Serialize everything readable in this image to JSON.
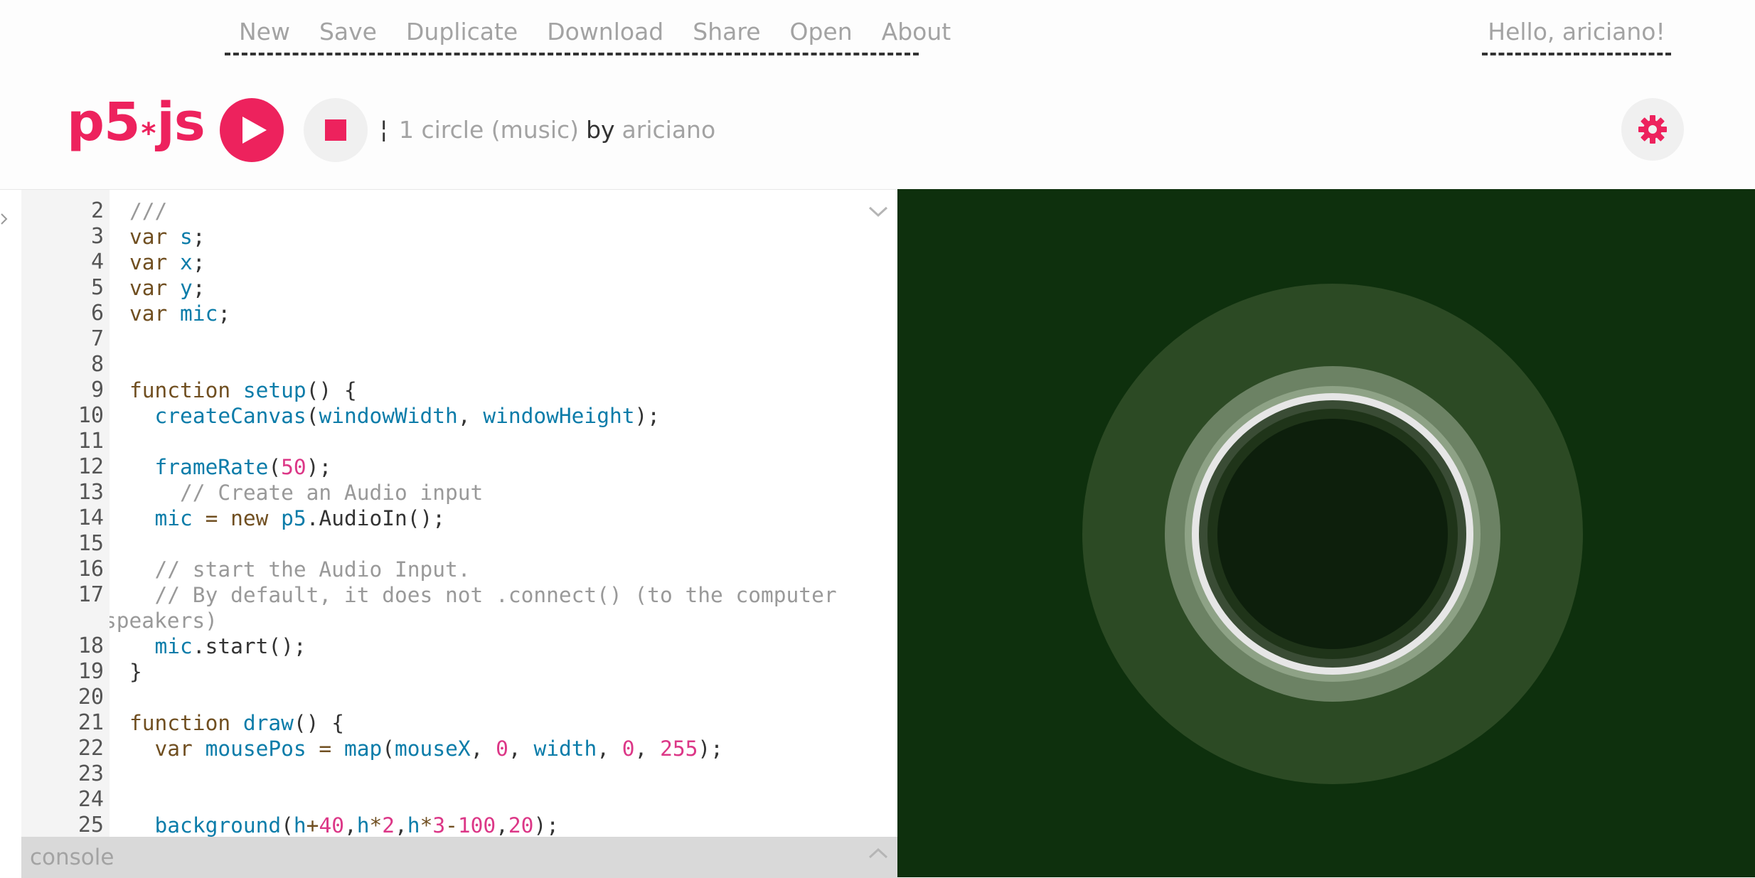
{
  "nav": {
    "items": [
      "New",
      "Save",
      "Duplicate",
      "Download",
      "Share",
      "Open",
      "About"
    ],
    "user_greeting": "Hello, ariciano!"
  },
  "toolbar": {
    "logo_text_a": "p5",
    "logo_text_b": "js",
    "pencil_glyph": "¦",
    "sketch_name": "1 circle (music)",
    "by_text": "by",
    "owner": "ariciano"
  },
  "editor": {
    "lines": [
      {
        "n": "2",
        "tokens": [
          [
            "cm",
            "///"
          ]
        ]
      },
      {
        "n": "3",
        "tokens": [
          [
            "kw",
            "var "
          ],
          [
            "var",
            "s"
          ],
          [
            "",
            ";"
          ]
        ]
      },
      {
        "n": "4",
        "tokens": [
          [
            "kw",
            "var "
          ],
          [
            "var",
            "x"
          ],
          [
            "",
            ";"
          ]
        ]
      },
      {
        "n": "5",
        "tokens": [
          [
            "kw",
            "var "
          ],
          [
            "var",
            "y"
          ],
          [
            "",
            ";"
          ]
        ]
      },
      {
        "n": "6",
        "tokens": [
          [
            "kw",
            "var "
          ],
          [
            "var",
            "mic"
          ],
          [
            "",
            ";"
          ]
        ]
      },
      {
        "n": "7",
        "tokens": []
      },
      {
        "n": "8",
        "tokens": []
      },
      {
        "n": "9",
        "tokens": [
          [
            "kw",
            "function "
          ],
          [
            "fn",
            "setup"
          ],
          [
            "",
            "() {"
          ]
        ]
      },
      {
        "n": "10",
        "tokens": [
          [
            "",
            "  "
          ],
          [
            "fn",
            "createCanvas"
          ],
          [
            "",
            "("
          ],
          [
            "var",
            "windowWidth"
          ],
          [
            "",
            ", "
          ],
          [
            "var",
            "windowHeight"
          ],
          [
            "",
            ");"
          ]
        ]
      },
      {
        "n": "11",
        "tokens": []
      },
      {
        "n": "12",
        "tokens": [
          [
            "",
            "  "
          ],
          [
            "fn",
            "frameRate"
          ],
          [
            "",
            "("
          ],
          [
            "num",
            "50"
          ],
          [
            "",
            ");"
          ]
        ]
      },
      {
        "n": "13",
        "tokens": [
          [
            "cm",
            "    // Create an Audio input"
          ]
        ]
      },
      {
        "n": "14",
        "tokens": [
          [
            "",
            "  "
          ],
          [
            "var",
            "mic"
          ],
          [
            "op",
            " = "
          ],
          [
            "kw",
            "new "
          ],
          [
            "var",
            "p5"
          ],
          [
            "",
            ".AudioIn();"
          ]
        ]
      },
      {
        "n": "15",
        "tokens": []
      },
      {
        "n": "16",
        "tokens": [
          [
            "cm",
            "  // start the Audio Input."
          ]
        ]
      },
      {
        "n": "17",
        "tokens": [
          [
            "cm",
            "  // By default, it does not .connect() (to the computer"
          ]
        ],
        "wrap": [
          [
            "cm",
            "speakers)"
          ]
        ]
      },
      {
        "n": "18",
        "tokens": [
          [
            "",
            "  "
          ],
          [
            "var",
            "mic"
          ],
          [
            "",
            ".start();"
          ]
        ]
      },
      {
        "n": "19",
        "tokens": [
          [
            "",
            "}"
          ]
        ]
      },
      {
        "n": "20",
        "tokens": []
      },
      {
        "n": "21",
        "tokens": [
          [
            "kw",
            "function "
          ],
          [
            "fn",
            "draw"
          ],
          [
            "",
            "() {"
          ]
        ]
      },
      {
        "n": "22",
        "tokens": [
          [
            "",
            "  "
          ],
          [
            "kw",
            "var "
          ],
          [
            "var",
            "mousePos"
          ],
          [
            "op",
            " = "
          ],
          [
            "fn",
            "map"
          ],
          [
            "",
            "("
          ],
          [
            "var",
            "mouseX"
          ],
          [
            "",
            ", "
          ],
          [
            "num",
            "0"
          ],
          [
            "",
            ", "
          ],
          [
            "var",
            "width"
          ],
          [
            "",
            ", "
          ],
          [
            "num",
            "0"
          ],
          [
            "",
            ", "
          ],
          [
            "num",
            "255"
          ],
          [
            "",
            ");"
          ]
        ]
      },
      {
        "n": "23",
        "tokens": []
      },
      {
        "n": "24",
        "tokens": []
      },
      {
        "n": "25",
        "tokens": [
          [
            "",
            "  "
          ],
          [
            "fn",
            "background"
          ],
          [
            "",
            "("
          ],
          [
            "var",
            "h"
          ],
          [
            "op",
            "+"
          ],
          [
            "num",
            "40"
          ],
          [
            "",
            ","
          ],
          [
            "var",
            "h"
          ],
          [
            "op",
            "*"
          ],
          [
            "num",
            "2"
          ],
          [
            "",
            ","
          ],
          [
            "var",
            "h"
          ],
          [
            "op",
            "*"
          ],
          [
            "num",
            "3"
          ],
          [
            "op",
            "-"
          ],
          [
            "num",
            "100"
          ],
          [
            "",
            ","
          ],
          [
            "num",
            "20"
          ],
          [
            "",
            ");"
          ]
        ]
      }
    ]
  },
  "console": {
    "label": "console"
  },
  "colors": {
    "accent": "#ed225d",
    "preview_bg": "#0e300d"
  },
  "icons": {
    "play": "play-icon",
    "stop": "stop-icon",
    "settings": "gear-icon",
    "fold": "chevron-down-icon",
    "console_toggle": "chevron-up-icon",
    "sidebar_toggle": "chevron-right-icon"
  }
}
